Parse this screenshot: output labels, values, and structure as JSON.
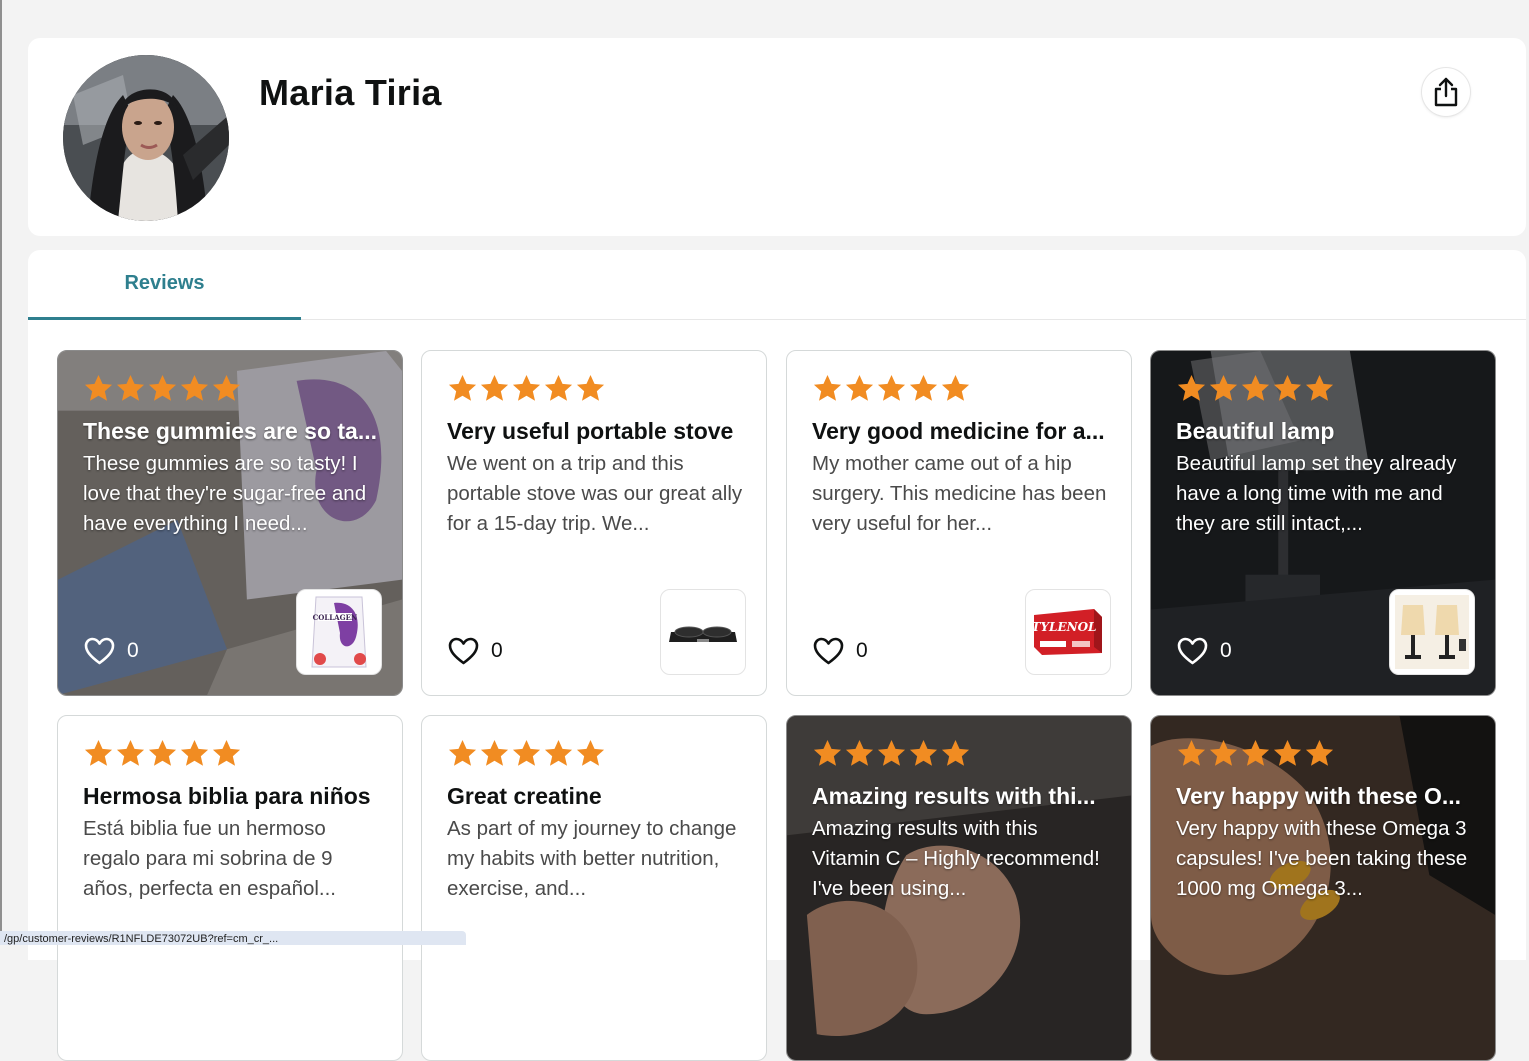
{
  "profile": {
    "name": "Maria Tiria"
  },
  "tabs": [
    {
      "label": "Reviews",
      "active": true
    }
  ],
  "colors": {
    "accent": "#2e7f8e",
    "star": "#f18c22"
  },
  "reviews": [
    {
      "rating": 5,
      "title": "These gummies are so ta...",
      "text": "These gummies are so tasty! I love that they're sugar-free and have everything I need...",
      "likes": "0",
      "has_photo": true,
      "thumbnail": "collagen-gummies-product"
    },
    {
      "rating": 5,
      "title": "Very useful portable stove",
      "text": "We went on a trip and this portable stove was our great ally for a 15-day trip. We...",
      "likes": "0",
      "has_photo": false,
      "thumbnail": "portable-stove-product"
    },
    {
      "rating": 5,
      "title": "Very good medicine for a...",
      "text": "My mother came out of a hip surgery. This medicine has been very useful for her...",
      "likes": "0",
      "has_photo": false,
      "thumbnail": "tylenol-product"
    },
    {
      "rating": 5,
      "title": "Beautiful lamp",
      "text": "Beautiful lamp set they already have a long time with me and they are still intact,...",
      "likes": "0",
      "has_photo": true,
      "thumbnail": "table-lamp-product"
    },
    {
      "rating": 5,
      "title": "Hermosa biblia para niños",
      "text": "Está biblia fue un hermoso regalo para mi sobrina de 9 años, perfecta en español...",
      "has_photo": false
    },
    {
      "rating": 5,
      "title": "Great creatine",
      "text": "As part of my journey to change my habits with better nutrition, exercise, and...",
      "has_photo": false
    },
    {
      "rating": 5,
      "title": "Amazing results with thi...",
      "text": "Amazing results with this Vitamin C – Highly recommend! I've been using...",
      "has_photo": true
    },
    {
      "rating": 5,
      "title": "Very happy with these O...",
      "text": "Very happy with these Omega 3 capsules! I've been taking these 1000 mg Omega 3...",
      "has_photo": true
    }
  ],
  "status_bar": {
    "url": "/gp/customer-reviews/R1NFLDE73072UB?ref=cm_cr_..."
  }
}
